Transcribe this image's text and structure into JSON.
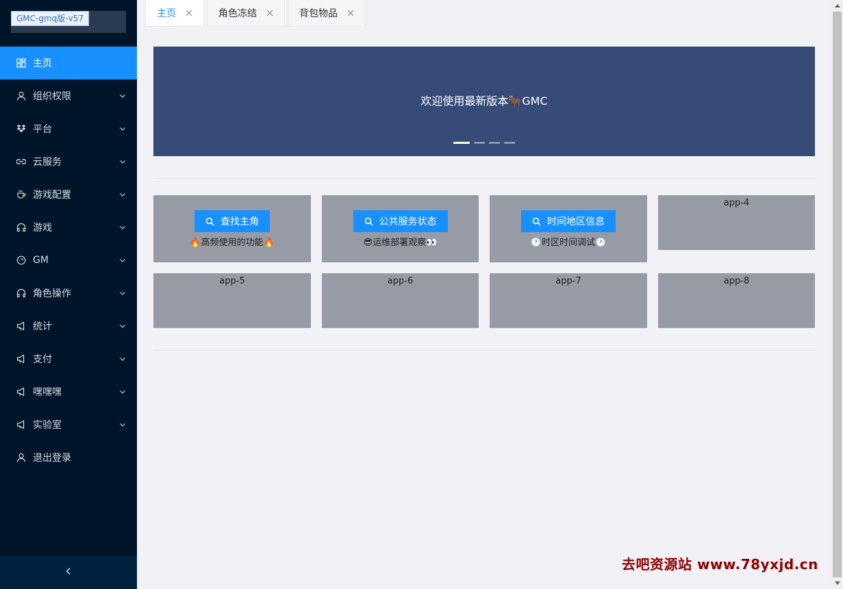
{
  "app": {
    "logo_tag": "GMC-gmq版-v57"
  },
  "sidebar": {
    "items": [
      {
        "label": "主页",
        "icon": "dashboard-icon",
        "active": true
      },
      {
        "label": "组织权限",
        "icon": "user-icon"
      },
      {
        "label": "平台",
        "icon": "dropbox-icon"
      },
      {
        "label": "云服务",
        "icon": "link-icon"
      },
      {
        "label": "游戏配置",
        "icon": "coffee-icon"
      },
      {
        "label": "游戏",
        "icon": "headphones-icon"
      },
      {
        "label": "GM",
        "icon": "dashboard-gauge-icon"
      },
      {
        "label": "角色操作",
        "icon": "headphones-icon"
      },
      {
        "label": "统计",
        "icon": "notification-icon"
      },
      {
        "label": "支付",
        "icon": "notification-icon"
      },
      {
        "label": "嘿嘿嘿",
        "icon": "notification-icon"
      },
      {
        "label": "实验室",
        "icon": "notification-icon"
      },
      {
        "label": "退出登录",
        "icon": "user-icon"
      }
    ]
  },
  "tabs": [
    {
      "label": "主页",
      "active": true
    },
    {
      "label": "角色冻结"
    },
    {
      "label": "背包物品"
    }
  ],
  "banner": {
    "text": "欢迎使用最新版本🐂GMC",
    "dots_total": 4,
    "dots_active": 1
  },
  "cards": [
    {
      "button": "查找主角",
      "desc": "🔥高频使用的功能🔥"
    },
    {
      "button": "公共服务状态",
      "desc": "😎运维部署观察👀"
    },
    {
      "button": "时间地区信息",
      "desc": "🕐时区时间调试🕐"
    },
    {
      "title": "app-4"
    },
    {
      "title": "app-5"
    },
    {
      "title": "app-6"
    },
    {
      "title": "app-7"
    },
    {
      "title": "app-8"
    }
  ],
  "watermark": "去吧资源站 www.78yxjd.cn",
  "colors": {
    "sidebar_bg": "#001529",
    "accent": "#1890ff",
    "banner_bg": "#374b78",
    "card_bg": "#979ba6",
    "page_bg": "#f2f2f6"
  }
}
